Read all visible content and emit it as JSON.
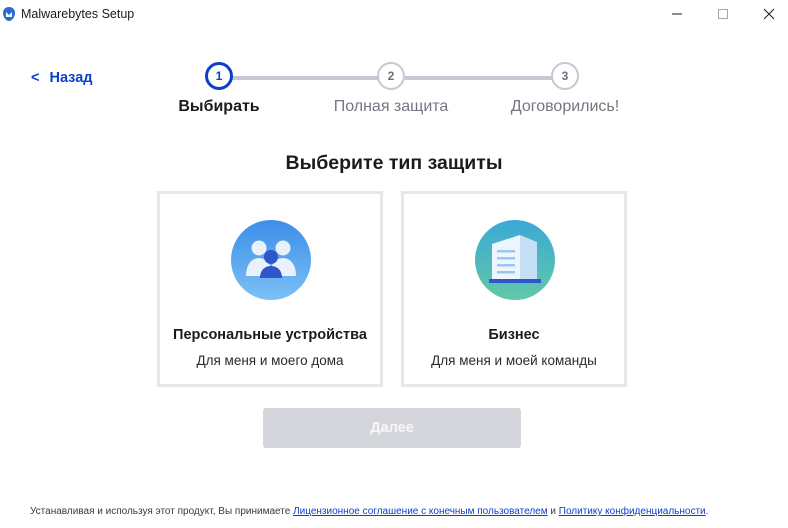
{
  "window": {
    "title": "Malwarebytes Setup",
    "icon": "malwarebytes-app-icon",
    "controls": [
      "minimize",
      "maximize",
      "close"
    ]
  },
  "nav": {
    "back_chevron": "<",
    "back_label": "Назад"
  },
  "stepper": {
    "current_step": 1,
    "steps": [
      {
        "number": "1",
        "label": "Выбирать",
        "state": "active"
      },
      {
        "number": "2",
        "label": "Полная защита",
        "state": "inactive"
      },
      {
        "number": "3",
        "label": "Договорились!",
        "state": "inactive"
      }
    ]
  },
  "main": {
    "heading": "Выберите тип защиты",
    "options": [
      {
        "title": "Персональные устройства",
        "subtitle": "Для меня и моего дома",
        "icon": "people-icon"
      },
      {
        "title": "Бизнес",
        "subtitle": "Для меня и моей команды",
        "icon": "office-building-icon"
      }
    ],
    "next_label": "Далее",
    "next_enabled": false
  },
  "footer": {
    "prefix": "Устанавливая и используя этот продукт, Вы принимаете ",
    "eula_link": "Лицензионное соглашение с конечным пользователем",
    "conjunction": " и ",
    "privacy_link": "Политику конфиденциальности",
    "suffix": "."
  },
  "colors": {
    "accent": "#0d3ecc",
    "inactive_step": "#c6c9d2",
    "card_border": "#e6e7ea",
    "disabled_button": "#d4d6db"
  }
}
